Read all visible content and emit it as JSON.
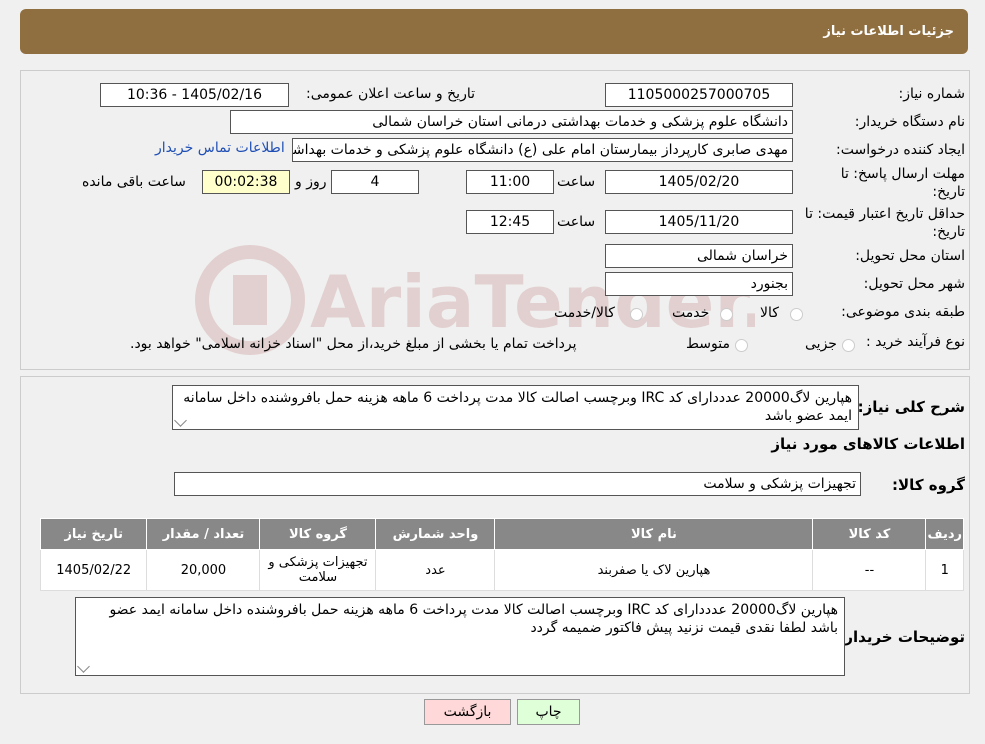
{
  "header": {
    "title": "جزئیات اطلاعات نیاز"
  },
  "form": {
    "need_number_label": "شماره نیاز:",
    "need_number": "1105000257000705",
    "announce_label": "تاریخ و ساعت اعلان عمومی:",
    "announce_value": "1405/02/16 - 10:36",
    "buyer_org_label": "نام دستگاه خریدار:",
    "buyer_org": "دانشگاه علوم پزشکی و خدمات بهداشتی درمانی استان خراسان شمالی",
    "creator_label": "ایجاد کننده درخواست:",
    "creator": "مهدی صابری کارپرداز بیمارستان امام علی (ع) دانشگاه علوم پزشکی و خدمات بهداشتی",
    "contact_link": "اطلاعات تماس خریدار",
    "deadline_label_1": "مهلت ارسال پاسخ: تا",
    "deadline_label_2": "تاریخ:",
    "deadline_date": "1405/02/20",
    "time_label": "ساعت",
    "deadline_time": "11:00",
    "days_value": "4",
    "days_label": "روز و",
    "remaining_time": "00:02:38",
    "remaining_label": "ساعت باقی مانده",
    "validity_label_1": "حداقل تاریخ اعتبار قیمت: تا",
    "validity_label_2": "تاریخ:",
    "validity_date": "1405/11/20",
    "validity_time": "12:45",
    "province_label": "استان محل تحویل:",
    "province": "خراسان شمالی",
    "city_label": "شهر محل تحویل:",
    "city": "بجنورد",
    "category_label": "طبقه بندی موضوعی:",
    "category_options": [
      "کالا",
      "خدمت",
      "کالا/خدمت"
    ],
    "process_label": "نوع فرآیند خرید :",
    "process_options": [
      "جزیی",
      "متوسط"
    ],
    "process_note": "پرداخت تمام یا بخشی از مبلغ خرید،از محل \"اسناد خزانه اسلامی\" خواهد بود."
  },
  "watermark": {
    "text": "AriaTender.neT"
  },
  "description": {
    "label": "شرح کلی نیاز:",
    "text": "هپارین لاگ20000 عدددارای  کد IRC وبرچسب اصالت کالا مدت پرداخت 6 ماهه هزینه حمل بافروشنده داخل سامانه ایمد عضو باشد"
  },
  "items_section": {
    "title": "اطلاعات کالاهای مورد نیاز",
    "group_label": "گروه کالا:",
    "group_value": "تجهیزات پزشکی و سلامت",
    "columns": [
      "ردیف",
      "کد کالا",
      "نام کالا",
      "واحد شمارش",
      "گروه کالا",
      "تعداد / مقدار",
      "تاریخ نیاز"
    ],
    "rows": [
      {
        "row": "1",
        "code": "--",
        "name": "هپارین لاک یا صفربند",
        "unit": "عدد",
        "group": "تجهیزات پزشکی و سلامت",
        "qty": "20,000",
        "date": "1405/02/22"
      }
    ]
  },
  "buyer_notes": {
    "label": "توضیحات خریدار:",
    "text": "هپارین لاگ20000 عدددارای  کد IRC وبرچسب اصالت کالا مدت پرداخت 6 ماهه هزینه حمل بافروشنده داخل سامانه ایمد عضو باشد لطفا نقدی قیمت نزنید  پیش فاکتور ضمیمه گردد"
  },
  "buttons": {
    "print": "چاپ",
    "back": "بازگشت"
  },
  "colors": {
    "header": "#8f6e3f",
    "link": "#1f4fb5",
    "back_button": "#ffd9d9",
    "print_button": "#dfffd9"
  }
}
